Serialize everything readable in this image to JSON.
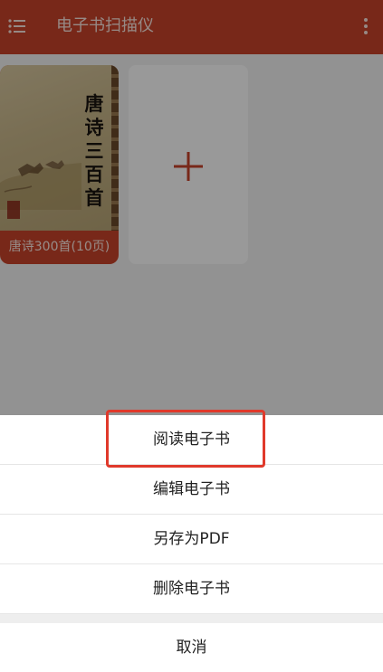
{
  "app": {
    "title": "电子书扫描仪",
    "menu_icon": "menu-icon",
    "more_icon": "more-vert-icon",
    "accent": "#c8442a"
  },
  "library": {
    "book": {
      "cover_title": "唐诗三百首",
      "label": "唐诗300首(10页)"
    },
    "add_icon": "plus-icon"
  },
  "action_sheet": {
    "items": [
      {
        "label": "阅读电子书"
      },
      {
        "label": "编辑电子书"
      },
      {
        "label": "另存为PDF"
      },
      {
        "label": "删除电子书"
      }
    ],
    "cancel": "取消",
    "highlight_color": "#e0392b"
  }
}
